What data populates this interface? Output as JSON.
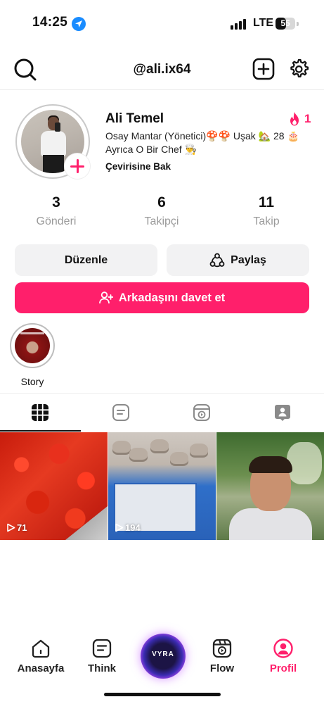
{
  "status_bar": {
    "time": "14:25",
    "network": "LTE",
    "battery_percent": "55",
    "battery_level": 0.55
  },
  "header": {
    "username": "@ali.ix64",
    "icons": [
      "search-icon",
      "add-icon",
      "gear-icon"
    ]
  },
  "profile": {
    "name": "Ali Temel",
    "streak_count": "1",
    "bio_line1": " Osay Mantar (Yönetici)🍄🍄 Uşak 🏡 28 🎂",
    "bio_line2": "Ayrıca O Bir Chef 👨‍🍳",
    "translate_link": "Çevirisine Bak"
  },
  "stats": [
    {
      "count": "3",
      "label": "Gönderi"
    },
    {
      "count": "6",
      "label": "Takipçi"
    },
    {
      "count": "11",
      "label": "Takip"
    }
  ],
  "actions": {
    "edit_label": "Düzenle",
    "share_label": "Paylaş",
    "invite_label": "Arkadaşını davet et"
  },
  "highlights": [
    {
      "label": "Story"
    }
  ],
  "tabs": [
    "grid-tab",
    "posts-tab",
    "reels-tab",
    "tagged-tab"
  ],
  "posts": [
    {
      "views": "71"
    },
    {
      "views": "194"
    },
    {
      "views": ""
    }
  ],
  "bottom_nav": {
    "items": [
      {
        "label": "Anasayfa"
      },
      {
        "label": "Think"
      },
      {
        "label": "VYRA"
      },
      {
        "label": "Flow"
      },
      {
        "label": "Profil"
      }
    ],
    "active": "Profil"
  },
  "colors": {
    "accent": "#ff1f6b",
    "muted_text": "#9a9a9a",
    "button_grey": "#f2f2f3"
  }
}
